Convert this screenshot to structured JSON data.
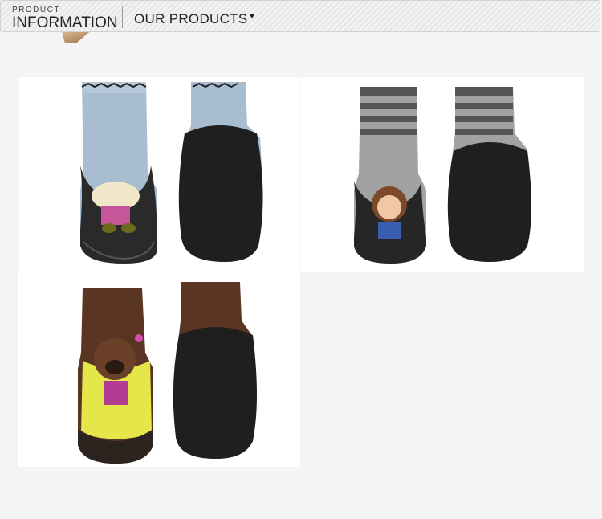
{
  "header": {
    "brand_small": "PRODUCT",
    "brand_big": "INFORMATION",
    "nav_label": "OUR PRODUCTS"
  },
  "colors": {
    "header_bg": "#eeeeee",
    "page_bg": "#f4f4f4",
    "sock_blue": "#a7bcd0",
    "sock_grey": "#9b9b9b",
    "sock_brown": "#5a3524",
    "sole_black": "#1f1f1f"
  },
  "photos": [
    {
      "alt": "Blue sock slippers with bear print",
      "icon": "product-photo"
    },
    {
      "alt": "Grey striped sock slippers with monkey print",
      "icon": "product-photo"
    },
    {
      "alt": "Brown sock slippers with bear print",
      "icon": "product-photo"
    }
  ]
}
